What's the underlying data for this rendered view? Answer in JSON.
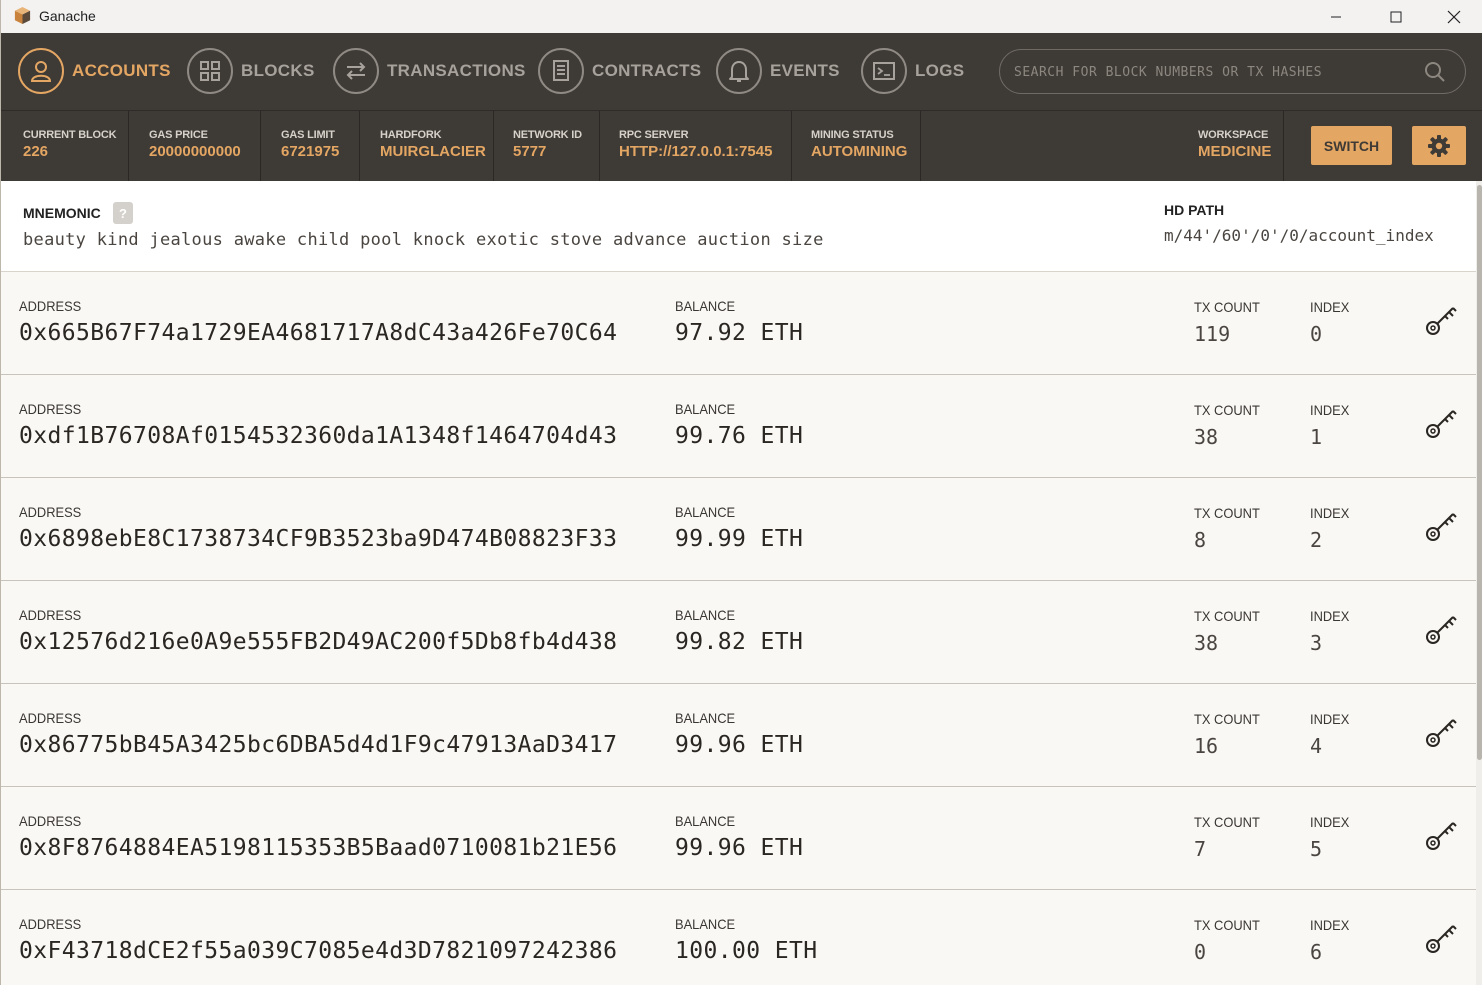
{
  "window": {
    "title": "Ganache",
    "minimize": "—",
    "maximize": "☐",
    "close": "✕"
  },
  "nav": {
    "items": [
      {
        "label": "ACCOUNTS",
        "icon": "user-icon",
        "active": true
      },
      {
        "label": "BLOCKS",
        "icon": "grid-icon",
        "active": false
      },
      {
        "label": "TRANSACTIONS",
        "icon": "swap-arrows-icon",
        "active": false
      },
      {
        "label": "CONTRACTS",
        "icon": "document-icon",
        "active": false
      },
      {
        "label": "EVENTS",
        "icon": "bell-icon",
        "active": false
      },
      {
        "label": "LOGS",
        "icon": "terminal-icon",
        "active": false
      }
    ],
    "search_placeholder": "SEARCH FOR BLOCK NUMBERS OR TX HASHES"
  },
  "status": {
    "current_block": {
      "label": "CURRENT BLOCK",
      "value": "226"
    },
    "gas_price": {
      "label": "GAS PRICE",
      "value": "20000000000"
    },
    "gas_limit": {
      "label": "GAS LIMIT",
      "value": "6721975"
    },
    "hardfork": {
      "label": "HARDFORK",
      "value": "MUIRGLACIER"
    },
    "network_id": {
      "label": "NETWORK ID",
      "value": "5777"
    },
    "rpc_server": {
      "label": "RPC SERVER",
      "value": "HTTP://127.0.0.1:7545"
    },
    "mining_status": {
      "label": "MINING STATUS",
      "value": "AUTOMINING"
    },
    "workspace": {
      "label": "WORKSPACE",
      "value": "MEDICINE"
    },
    "switch_label": "SWITCH"
  },
  "mnemonic": {
    "label": "MNEMONIC",
    "help": "?",
    "words": "beauty kind jealous awake child pool knock exotic stove advance auction size",
    "hd_path_label": "HD PATH",
    "hd_path": "m/44'/60'/0'/0/account_index"
  },
  "accounts_labels": {
    "address": "ADDRESS",
    "balance": "BALANCE",
    "tx_count": "TX COUNT",
    "index": "INDEX"
  },
  "accounts": [
    {
      "address": "0x665B67F74a1729EA4681717A8dC43a426Fe70C64",
      "balance": "97.92 ETH",
      "tx_count": "119",
      "index": "0"
    },
    {
      "address": "0xdf1B76708Af0154532360da1A1348f1464704d43",
      "balance": "99.76 ETH",
      "tx_count": "38",
      "index": "1"
    },
    {
      "address": "0x6898ebE8C1738734CF9B3523ba9D474B08823F33",
      "balance": "99.99 ETH",
      "tx_count": "8",
      "index": "2"
    },
    {
      "address": "0x12576d216e0A9e555FB2D49AC200f5Db8fb4d438",
      "balance": "99.82 ETH",
      "tx_count": "38",
      "index": "3"
    },
    {
      "address": "0x86775bB45A3425bc6DBA5d4d1F9c47913AaD3417",
      "balance": "99.96 ETH",
      "tx_count": "16",
      "index": "4"
    },
    {
      "address": "0x8F8764884EA5198115353B5Baad0710081b21E56",
      "balance": "99.96 ETH",
      "tx_count": "7",
      "index": "5"
    },
    {
      "address": "0xF43718dCE2f55a039C7085e4d3D7821097242386",
      "balance": "100.00 ETH",
      "tx_count": "0",
      "index": "6"
    }
  ],
  "colors": {
    "accent": "#e4a663",
    "header_bg": "#3e3a36",
    "body_bg": "#f9f8f5"
  }
}
